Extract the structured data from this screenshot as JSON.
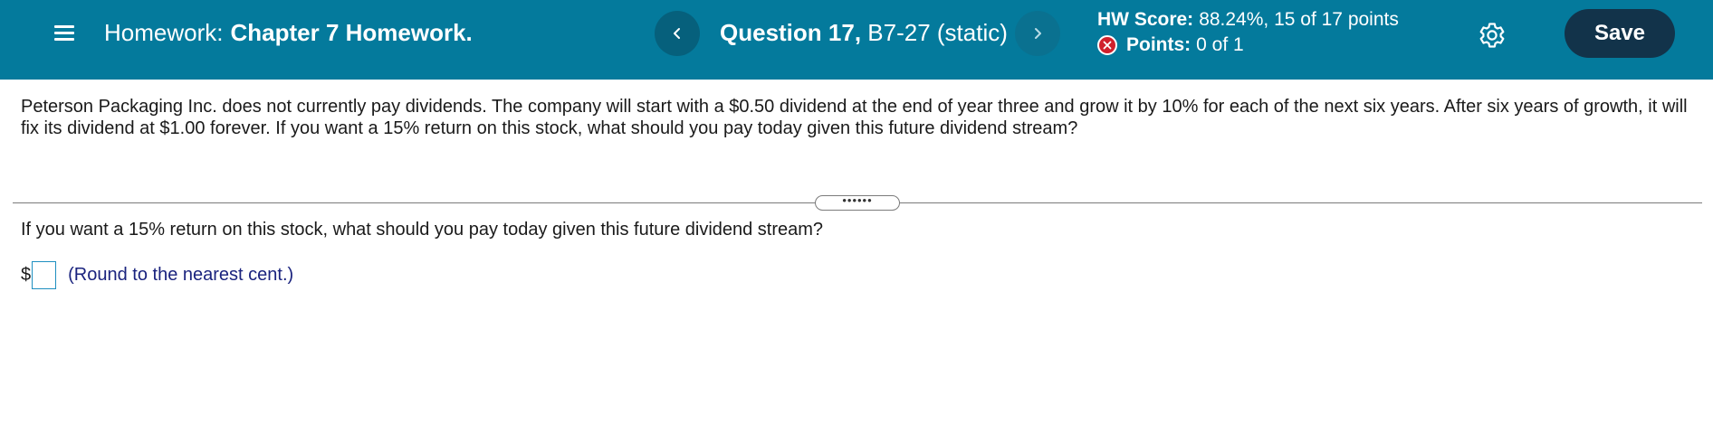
{
  "header": {
    "homework_label": "Homework:",
    "homework_name": "Chapter 7 Homework.",
    "question_number": "Question 17,",
    "question_id": "B7-27 (static)",
    "score_label": "HW Score:",
    "score_value": "88.24%, 15 of 17 points",
    "points_label": "Points:",
    "points_value": "0 of 1",
    "save_label": "Save",
    "icons": {
      "menu": "hamburger-menu-icon",
      "prev": "chevron-left-icon",
      "next": "chevron-right-icon",
      "incorrect": "x-circle-icon",
      "settings": "gear-icon"
    },
    "colors": {
      "header_bg": "#047a9c",
      "save_bg": "#12334a",
      "incorrect": "#d0202c"
    }
  },
  "question": {
    "text": "Peterson Packaging Inc. does not currently pay dividends.  The company will start with a $0.50 dividend at the end of year three and grow it by 10% for each of the next six years.  After six years of growth, it will fix its dividend at $1.00 forever.  If you want a 15% return on this stock, what should you pay today given this future dividend stream?",
    "expander_label": "••••••",
    "prompt": "If you want a 15% return on this stock, what should you pay today given this future dividend stream?",
    "currency_symbol": "$",
    "answer_value": "",
    "hint": "(Round to the nearest cent.)"
  }
}
